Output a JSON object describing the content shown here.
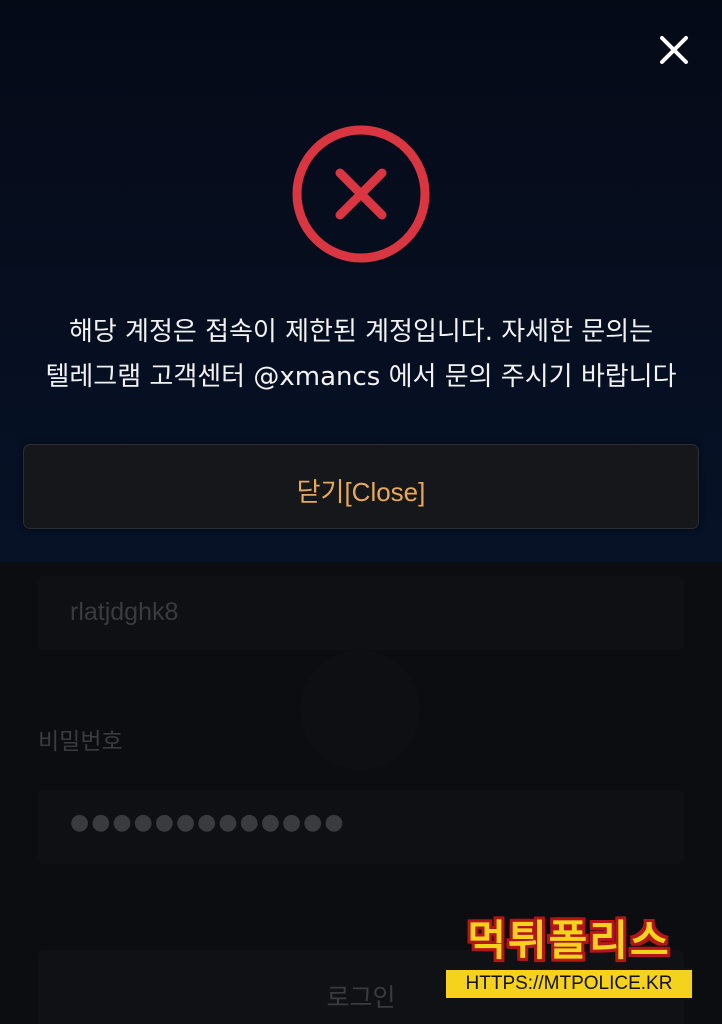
{
  "modal": {
    "message_line1": "해당 계정은 접속이 제한된 계정입니다. 자세한 문의는",
    "message_line2": "텔레그램 고객센터 @xmancs 에서 문의 주시기 바랍니다",
    "close_button_label": "닫기[Close]",
    "close_icon": "close-icon",
    "status_icon": "error-circle-x-icon",
    "error_color": "#d93642",
    "accent_color": "#e8a85a"
  },
  "login_form": {
    "username_value": "rlatjdghk8",
    "password_label": "비밀번호",
    "password_value": "●●●●●●●●●●●●●",
    "login_button_label": "로그인"
  },
  "watermark": {
    "title": "먹튀폴리스",
    "url": "HTTPS://MTPOLICE.KR"
  }
}
